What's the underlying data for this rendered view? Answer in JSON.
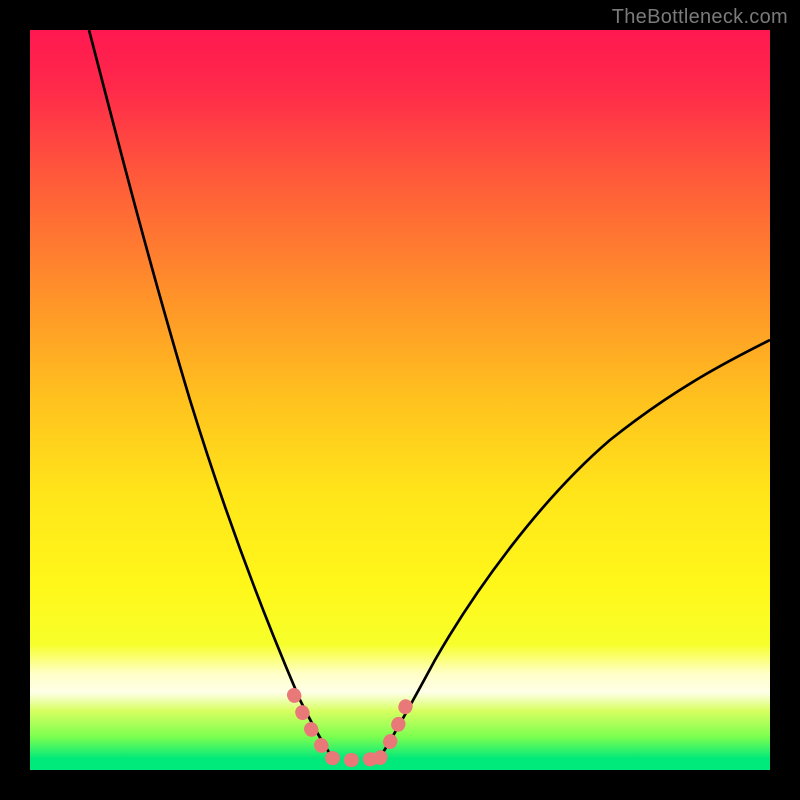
{
  "watermark": "TheBottleneck.com",
  "chart_data": {
    "type": "line",
    "title": "",
    "xlabel": "",
    "ylabel": "",
    "xlim": [
      0,
      100
    ],
    "ylim": [
      0,
      100
    ],
    "background_gradient": [
      "#ff1a4a",
      "#ffde00",
      "#00e97b"
    ],
    "series": [
      {
        "name": "left-branch",
        "x": [
          8,
          10,
          12.5,
          15,
          17.5,
          20,
          22.5,
          25,
          27.5,
          30,
          32,
          34,
          36,
          37.5,
          39
        ],
        "values": [
          100,
          92,
          82,
          72,
          63,
          54,
          46,
          38,
          30,
          23,
          17.5,
          12,
          7.5,
          4,
          1.5
        ]
      },
      {
        "name": "right-branch",
        "x": [
          47,
          49,
          51,
          53,
          56,
          60,
          65,
          70,
          75,
          80,
          85,
          90,
          95,
          100
        ],
        "values": [
          1.5,
          4,
          7,
          10,
          14,
          19,
          25,
          30.5,
          35.5,
          40,
          44.5,
          48.5,
          52,
          55
        ]
      },
      {
        "name": "bottom-pink-highlight-left",
        "x": [
          35.5,
          37,
          38,
          39,
          40
        ],
        "values": [
          8.5,
          5,
          3,
          1.8,
          1.3
        ]
      },
      {
        "name": "bottom-pink-flat",
        "x": [
          40,
          42,
          44,
          46
        ],
        "values": [
          1.3,
          1.2,
          1.2,
          1.3
        ]
      },
      {
        "name": "bottom-pink-highlight-right",
        "x": [
          46,
          47,
          48,
          49,
          50
        ],
        "values": [
          1.3,
          2.2,
          4,
          6,
          8.5
        ]
      }
    ],
    "annotations": []
  }
}
